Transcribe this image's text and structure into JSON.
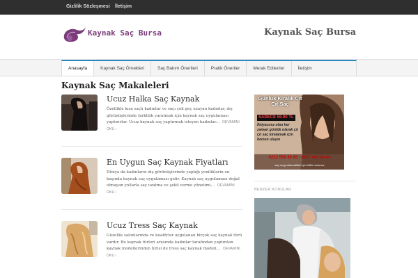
{
  "topbar": {
    "links": [
      "Gizlilik Sözleşmesi",
      "İletişim"
    ]
  },
  "header": {
    "logo_text": "Kaynak Saç Bursa",
    "site_title": "Kaynak Saç Bursa"
  },
  "nav": {
    "items": [
      "Anasayfa",
      "Kaynak Saç Örnekleri",
      "Saç Bakım Önerileri",
      "Pratik Öneriler",
      "Merak Edilenler",
      "İletişim"
    ],
    "active": "Anasayfa"
  },
  "main": {
    "title": "Kaynak Saç Makaleleri",
    "posts": [
      {
        "title": "Ucuz Halka Saç Kaynak",
        "excerpt": "Özellikle kısa saçlı kadınlar ve saçı çok geç uzayan kadınlar, dış görünüşlerinde farklılık yaratmak için kaynak saç uygulaması yaptırırlar. Ucuz kaynak saç yaptırmak isteyen kadınlar...",
        "read_more": "DEVAMINI OKU ›"
      },
      {
        "title": "En Uygun Saç Kaynak Fiyatları",
        "excerpt": "Dünya da kadınların dış görünüşlerinde yaptığı yeniliklerin en başında kaynak saç uygulaması gelir. Kaynak saç uygulaması doğal olmayan yollarla saç uzatma ve şekil verme yönetimi...",
        "read_more": "DEVAMINI OKU ›"
      },
      {
        "title": "Ucuz Tress Saç Kaynak",
        "excerpt": "Güzellik salonlarında ve kuaförler uygulanan birçok saç kaynak türü vardır. Bu kaynak türleri arasında kadınlar tarafından yaptırılan kaynak modellerinden birisi de tress saç kaynak modeli...",
        "read_more": "DEVAMINI OKU ›"
      }
    ]
  },
  "sidebar": {
    "ad": {
      "title": "Günlük Kiralık Çıt Çıt Saç",
      "price": "SADECE 59.90 TL",
      "body": "İhtiyacınız olan her zaman günlük olarak çıt çıt saç kiralamak için hemen ulaşın",
      "phone": "0212 559 85 65 - 0537 462 44 44",
      "note": "saç rengi alternatifleri için lütfen sorunuz"
    },
    "related_heading": "BENZER KONULAR"
  },
  "colors": {
    "accent": "#2a86c1",
    "topbar": "#2f2f2f",
    "logo": "#7a3d7a"
  }
}
